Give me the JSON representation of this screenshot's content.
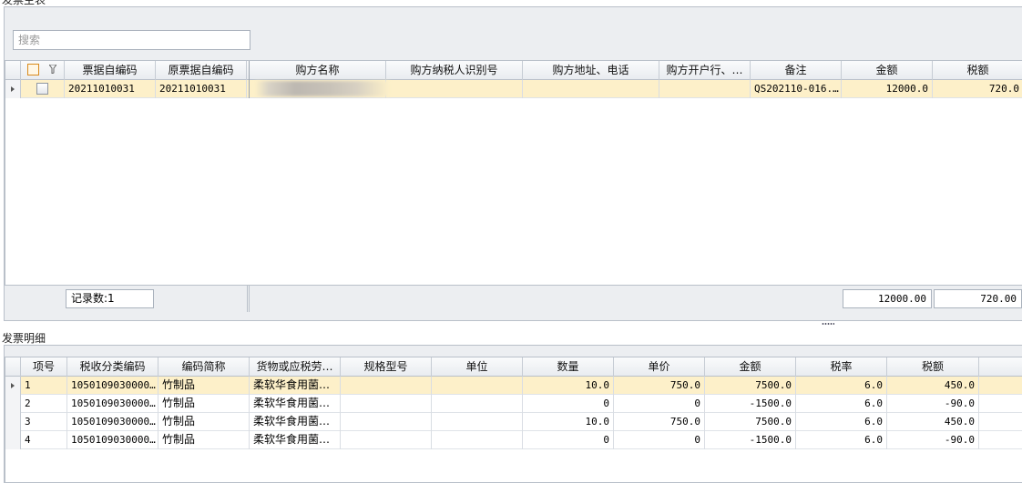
{
  "top_panel": {
    "title": "发票主表",
    "search_placeholder": "搜索",
    "columns": [
      "票据自编码",
      "原票据自编码",
      "购方名称",
      "购方纳税人识别号",
      "购方地址、电话",
      "购方开户行、…",
      "备注",
      "金额",
      "税额"
    ],
    "rows": [
      {
        "code": "20211010031",
        "orig_code": "20211010031",
        "buyer_name": "",
        "buyer_tax_id": "",
        "buyer_addr": "",
        "buyer_bank": "",
        "remark": "QS202110-016.…",
        "amount": "12000.0",
        "tax": "720.0"
      }
    ],
    "footer": {
      "record_count": "记录数:1",
      "total_amount": "12000.00",
      "total_tax": "720.00"
    }
  },
  "bottom_panel": {
    "title": "发票明细",
    "columns": [
      "项号",
      "税收分类编码",
      "编码简称",
      "货物或应税劳…",
      "规格型号",
      "单位",
      "数量",
      "单价",
      "金额",
      "税率",
      "税额"
    ],
    "rows": [
      {
        "no": "1",
        "tax_code": "1050109030000…",
        "short": "竹制品",
        "goods": "柔软华食用菌…",
        "spec": "",
        "unit": "",
        "qty": "10.0",
        "price": "750.0",
        "amount": "7500.0",
        "rate": "6.0",
        "tax": "450.0"
      },
      {
        "no": "2",
        "tax_code": "1050109030000…",
        "short": "竹制品",
        "goods": "柔软华食用菌…",
        "spec": "",
        "unit": "",
        "qty": "0",
        "price": "0",
        "amount": "-1500.0",
        "rate": "6.0",
        "tax": "-90.0"
      },
      {
        "no": "3",
        "tax_code": "1050109030000…",
        "short": "竹制品",
        "goods": "柔软华食用菌…",
        "spec": "",
        "unit": "",
        "qty": "10.0",
        "price": "750.0",
        "amount": "7500.0",
        "rate": "6.0",
        "tax": "450.0"
      },
      {
        "no": "4",
        "tax_code": "1050109030000…",
        "short": "竹制品",
        "goods": "柔软华食用菌…",
        "spec": "",
        "unit": "",
        "qty": "0",
        "price": "0",
        "amount": "-1500.0",
        "rate": "6.0",
        "tax": "-90.0"
      }
    ]
  },
  "colors": {
    "selected_row": "#fdf0c9",
    "panel_bg": "#eceef1",
    "border": "#b9c0c9",
    "checkbox_accent": "#d98a1a"
  },
  "icons": [
    "filter-icon",
    "row-indicator-icon",
    "splitter-grip-icon"
  ]
}
